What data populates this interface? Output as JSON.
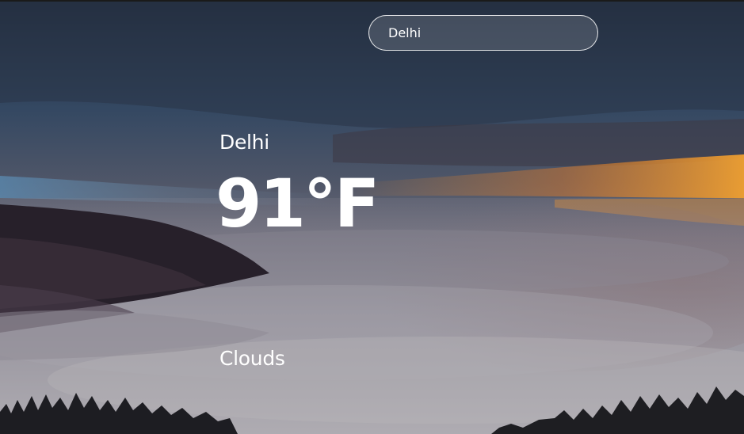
{
  "search": {
    "value": "Delhi"
  },
  "weather": {
    "city": "Delhi",
    "temperature": "91°F",
    "condition": "Clouds"
  },
  "colors": {
    "text": "#ffffff",
    "sky_top": "#222d3d",
    "sunset_orange": "#e58a2c",
    "fog": "#9b98a0"
  }
}
